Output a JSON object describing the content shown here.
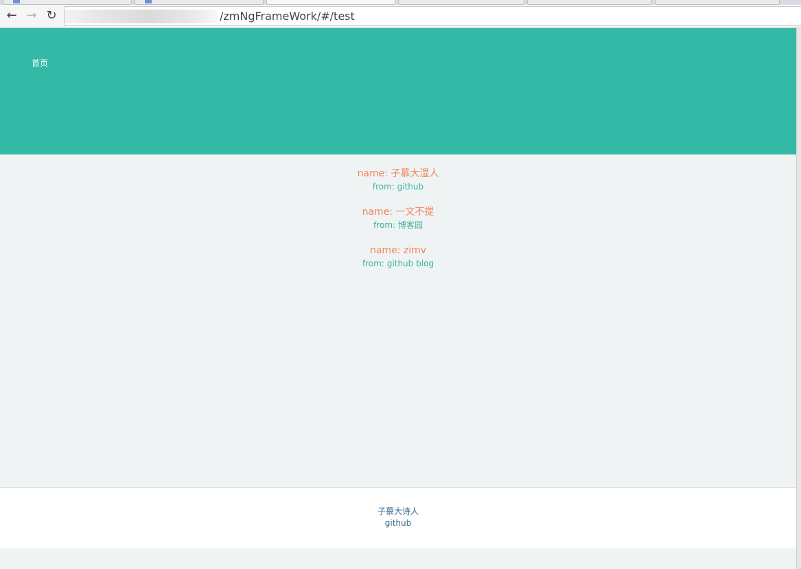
{
  "browser": {
    "address": {
      "url_visible": "/zmNgFrameWork/#/test"
    },
    "buttons": {
      "back_icon": "arrow-left",
      "forward_icon": "arrow-right",
      "reload_icon": "reload"
    }
  },
  "header": {
    "nav": {
      "home_label": "首页"
    },
    "color": "#33baa6"
  },
  "main": {
    "items": [
      {
        "name": "name: 子慕大湿人",
        "from": "from: github"
      },
      {
        "name": "name: 一文不提",
        "from": "from: 博客园"
      },
      {
        "name": "name: zimv",
        "from": "from: github blog"
      }
    ],
    "name_color": "#f0855c",
    "from_color": "#3ab39a"
  },
  "footer": {
    "author": "子慕大诗人",
    "link": "github"
  }
}
